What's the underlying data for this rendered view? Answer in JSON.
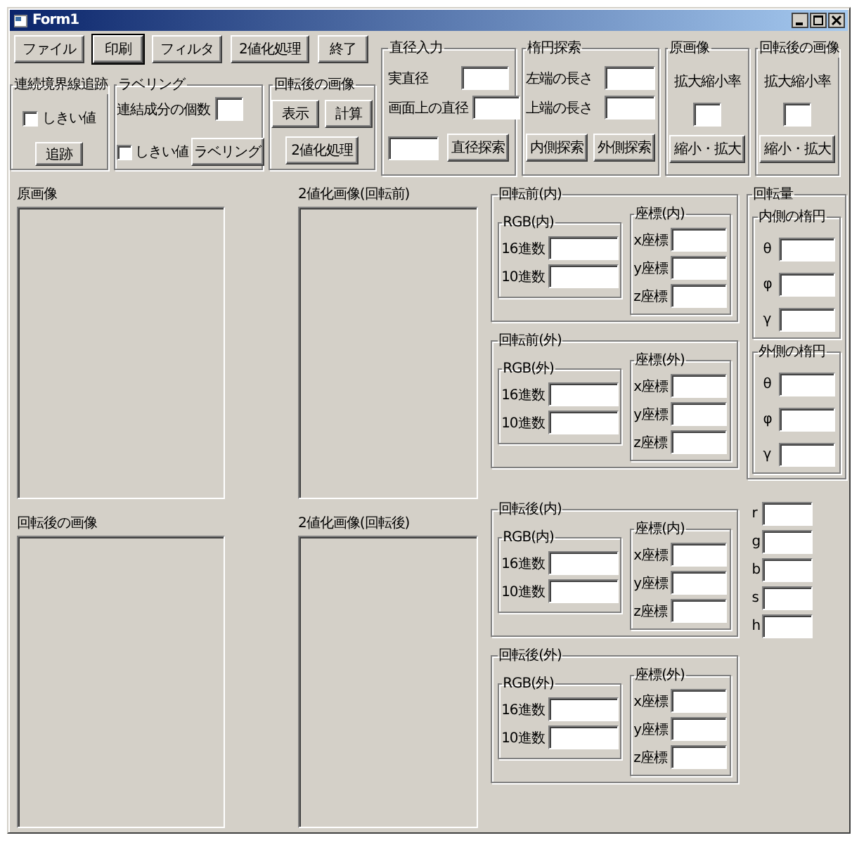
{
  "window": {
    "title": "Form1"
  },
  "menu_buttons": [
    {
      "label": "ファイル",
      "focused": false
    },
    {
      "label": "印刷",
      "focused": true
    },
    {
      "label": "フィルタ",
      "focused": false
    },
    {
      "label": "2値化処理",
      "focused": false
    },
    {
      "label": "終了",
      "focused": false
    }
  ],
  "trace_group": {
    "title": "連続境界線追跡",
    "checkbox": {
      "label": "しきい値",
      "checked": false
    },
    "button": "追跡"
  },
  "labeling_group": {
    "title": "ラベリング",
    "count_label": "連結成分の個数",
    "checkbox": {
      "label": "しきい値",
      "checked": false
    },
    "button": "ラベリング"
  },
  "rotated_group": {
    "title": "回転後の画像",
    "buttons": [
      "表示",
      "計算",
      "2値化処理"
    ]
  },
  "diameter_group": {
    "title": "直径入力",
    "fields": [
      {
        "label": "実直径"
      },
      {
        "label": "画面上の直径"
      }
    ],
    "button": "直径探索"
  },
  "ellipse_group": {
    "title": "楕円探索",
    "fields": [
      {
        "label": "左端の長さ"
      },
      {
        "label": "上端の長さ"
      }
    ],
    "buttons": [
      "内側探索",
      "外側探索"
    ]
  },
  "scale_groups": [
    {
      "title": "原画像",
      "label": "拡大縮小率",
      "button": "縮小・拡大"
    },
    {
      "title": "回転後の画像",
      "label": "拡大縮小率",
      "button": "縮小・拡大"
    }
  ],
  "image_panels": [
    {
      "label": "原画像"
    },
    {
      "label": "2値化画像(回転前)"
    },
    {
      "label": "回転後の画像"
    },
    {
      "label": "2値化画像(回転後)"
    }
  ],
  "color_groups": [
    {
      "title": "回転前(内)",
      "rgb_title": "RGB(内)",
      "rgb_fields": [
        "16進数",
        "10進数"
      ],
      "coord_title": "座標(内)",
      "coord_fields": [
        "x座標",
        "y座標",
        "z座標"
      ]
    },
    {
      "title": "回転前(外)",
      "rgb_title": "RGB(外)",
      "rgb_fields": [
        "16進数",
        "10進数"
      ],
      "coord_title": "座標(外)",
      "coord_fields": [
        "x座標",
        "y座標",
        "z座標"
      ]
    },
    {
      "title": "回転後(内)",
      "rgb_title": "RGB(内)",
      "rgb_fields": [
        "16進数",
        "10進数"
      ],
      "coord_title": "座標(内)",
      "coord_fields": [
        "x座標",
        "y座標",
        "z座標"
      ]
    },
    {
      "title": "回転後(外)",
      "rgb_title": "RGB(外)",
      "rgb_fields": [
        "16進数",
        "10進数"
      ],
      "coord_title": "座標(外)",
      "coord_fields": [
        "x座標",
        "y座標",
        "z座標"
      ]
    }
  ],
  "rotation_group": {
    "title": "回転量",
    "subgroups": [
      {
        "title": "内側の楕円",
        "fields": [
          "θ",
          "φ",
          "γ"
        ]
      },
      {
        "title": "外側の楕円",
        "fields": [
          "θ",
          "φ",
          "γ"
        ]
      }
    ]
  },
  "hsv_fields": [
    "r",
    "g",
    "b",
    "s",
    "h"
  ]
}
